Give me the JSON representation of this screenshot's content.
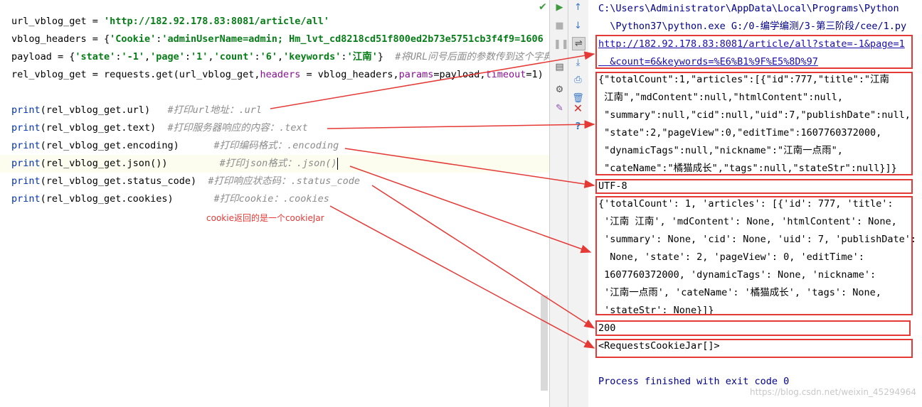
{
  "editor": {
    "lines": [
      {
        "t": [
          [
            "url_vblog_get = ",
            ""
          ],
          [
            "'http://182.92.178.83:8081/article/all'",
            "str"
          ]
        ]
      },
      {
        "t": [
          [
            "vblog_headers = {",
            ""
          ],
          [
            "'Cookie'",
            "str"
          ],
          [
            ":",
            ""
          ],
          [
            "'adminUserName=admin; Hm_lvt_cd8218cd51f800ed2b73e5751cb3f4f9=1606",
            "str"
          ]
        ]
      },
      {
        "t": [
          [
            "payload = {",
            ""
          ],
          [
            "'state'",
            "str"
          ],
          [
            ":",
            ""
          ],
          [
            "'-1'",
            "str"
          ],
          [
            ",",
            ""
          ],
          [
            "'page'",
            "str"
          ],
          [
            ":",
            ""
          ],
          [
            "'1'",
            "str"
          ],
          [
            ",",
            ""
          ],
          [
            "'count'",
            "str"
          ],
          [
            ":",
            ""
          ],
          [
            "'6'",
            "str"
          ],
          [
            ",",
            ""
          ],
          [
            "'keywords'",
            "str"
          ],
          [
            ":",
            ""
          ],
          [
            "'江南'",
            "str"
          ],
          [
            "}  ",
            ""
          ],
          [
            "#将URL问号后面的参数传到这个字典里",
            "cm"
          ]
        ]
      },
      {
        "t": [
          [
            "rel_vblog_get = requests.get(url_vblog_get,",
            ""
          ],
          [
            "headers",
            "param"
          ],
          [
            " = vblog_headers,",
            ""
          ],
          [
            "params",
            "param"
          ],
          [
            "=payload,",
            ""
          ],
          [
            "timeout",
            "param"
          ],
          [
            "=1)",
            ""
          ]
        ]
      },
      {
        "t": []
      },
      {
        "t": [
          [
            "print",
            "kw"
          ],
          [
            "(rel_vblog_get.url)   ",
            ""
          ],
          [
            "#打印url地址：.url",
            "cm"
          ]
        ]
      },
      {
        "t": [
          [
            "print",
            "kw"
          ],
          [
            "(rel_vblog_get.text)  ",
            ""
          ],
          [
            "#打印服务器响应的内容：.text",
            "cm"
          ]
        ]
      },
      {
        "t": [
          [
            "print",
            "kw"
          ],
          [
            "(rel_vblog_get.encoding)      ",
            ""
          ],
          [
            "#打印编码格式：.encoding",
            "cm"
          ]
        ]
      },
      {
        "t": [
          [
            "print",
            "kw"
          ],
          [
            "(rel_vblog_get.json())         ",
            ""
          ],
          [
            "#打印json格式：.json()",
            "cm"
          ]
        ],
        "caret": true
      },
      {
        "t": [
          [
            "print",
            "kw"
          ],
          [
            "(rel_vblog_get.status_code)  ",
            ""
          ],
          [
            "#打印响应状态码：.status_code",
            "cm"
          ]
        ]
      },
      {
        "t": [
          [
            "print",
            "kw"
          ],
          [
            "(rel_vblog_get.cookies)       ",
            ""
          ],
          [
            "#打印cookie：.cookies",
            "cm"
          ]
        ]
      }
    ],
    "note": "cookie返回的是一个cookieJar"
  },
  "toolbar_left": [
    "run-icon",
    "stop-icon",
    "pause-icon",
    "layout-icon",
    "settings-icon",
    "pin-icon"
  ],
  "toolbar_right": [
    "up-arrow-icon",
    "down-arrow-icon",
    "soft-wrap-icon",
    "scroll-end-icon",
    "print-icon",
    "trash-icon"
  ],
  "console": {
    "lines": [
      {
        "text": "C:\\Users\\Administrator\\AppData\\Local\\Programs\\Python",
        "kind": "path"
      },
      {
        "text": "  \\Python37\\python.exe G:/0-编学编测/3-第三阶段/cee/1.py",
        "kind": "path"
      },
      {
        "text": "http://182.92.178.83:8081/article/all?state=-1&page=1",
        "kind": "link"
      },
      {
        "text": "  &count=6&keywords=%E6%B1%9F%E5%8D%97",
        "kind": "link"
      },
      {
        "text": "{\"totalCount\":1,\"articles\":[{\"id\":777,\"title\":\"江南",
        "kind": "out"
      },
      {
        "text": " 江南\",\"mdContent\":null,\"htmlContent\":null,",
        "kind": "out"
      },
      {
        "text": " \"summary\":null,\"cid\":null,\"uid\":7,\"publishDate\":null,",
        "kind": "out"
      },
      {
        "text": " \"state\":2,\"pageView\":0,\"editTime\":1607760372000,",
        "kind": "out"
      },
      {
        "text": " \"dynamicTags\":null,\"nickname\":\"江南一点雨\",",
        "kind": "out"
      },
      {
        "text": " \"cateName\":\"橘猫成长\",\"tags\":null,\"stateStr\":null}]}",
        "kind": "out"
      },
      {
        "text": "UTF-8",
        "kind": "out"
      },
      {
        "text": "{'totalCount': 1, 'articles': [{'id': 777, 'title':",
        "kind": "out"
      },
      {
        "text": " '江南 江南', 'mdContent': None, 'htmlContent': None,",
        "kind": "out"
      },
      {
        "text": " 'summary': None, 'cid': None, 'uid': 7, 'publishDate':",
        "kind": "out"
      },
      {
        "text": "  None, 'state': 2, 'pageView': 0, 'editTime':",
        "kind": "out"
      },
      {
        "text": " 1607760372000, 'dynamicTags': None, 'nickname':",
        "kind": "out"
      },
      {
        "text": " '江南一点雨', 'cateName': '橘猫成长', 'tags': None,",
        "kind": "out"
      },
      {
        "text": " 'stateStr': None}]}",
        "kind": "out"
      },
      {
        "text": "200",
        "kind": "out"
      },
      {
        "text": "<RequestsCookieJar[]>",
        "kind": "out"
      },
      {
        "text": "",
        "kind": "out"
      },
      {
        "text": "Process finished with exit code 0",
        "kind": "done"
      }
    ],
    "watermark": "https://blog.csdn.net/weixin_45294964"
  },
  "colors": {
    "annotation_red": "#e53935",
    "string_green": "#067d17",
    "keyword_blue": "#0033b3",
    "comment_gray": "#8c8c8c"
  }
}
